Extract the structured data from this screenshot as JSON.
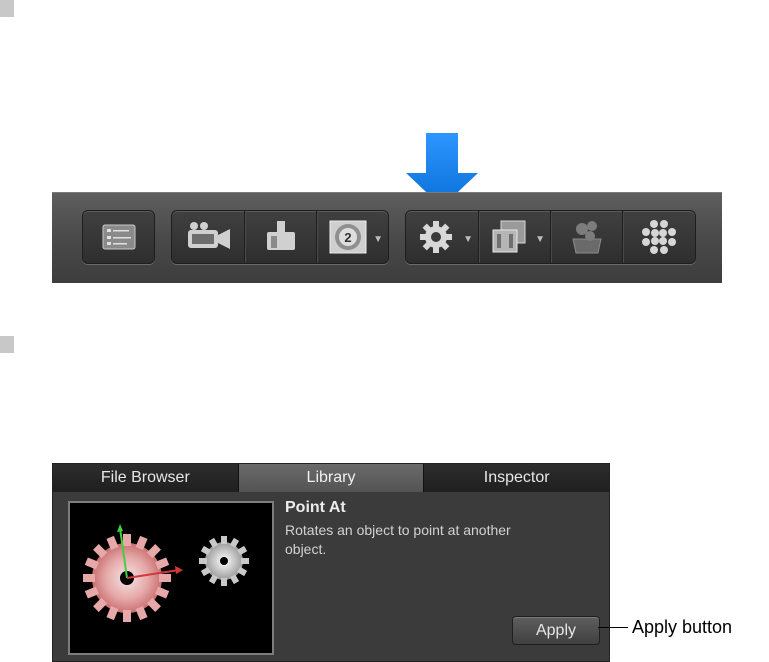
{
  "toolbar": {
    "groups": [
      {
        "buttons": [
          {
            "icon": "layers-list-icon"
          }
        ]
      },
      {
        "buttons": [
          {
            "icon": "add-camera-icon"
          },
          {
            "icon": "add-light-icon"
          },
          {
            "icon": "countdown-generator-icon",
            "has_menu": true
          }
        ]
      },
      {
        "buttons": [
          {
            "icon": "behaviors-gear-icon",
            "has_menu": true
          },
          {
            "icon": "filters-icon",
            "has_menu": true
          },
          {
            "icon": "particles-icon"
          },
          {
            "icon": "replicator-icon"
          }
        ]
      }
    ],
    "highlight": {
      "target": "behaviors-gear-icon",
      "color": "#1a7fe6"
    }
  },
  "library": {
    "tabs": [
      "File Browser",
      "Library",
      "Inspector"
    ],
    "active_tab": "Library",
    "item_title": "Point At",
    "item_description": "Rotates an object to point at another object.",
    "apply_label": "Apply"
  },
  "callout": {
    "label": "Apply button"
  }
}
